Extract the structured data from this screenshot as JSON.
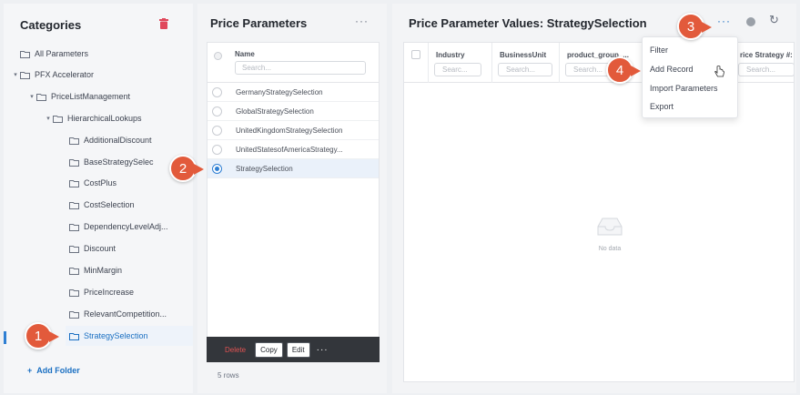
{
  "categories": {
    "title": "Categories",
    "items": [
      {
        "label": "All Parameters"
      },
      {
        "label": "PFX Accelerator"
      },
      {
        "label": "PriceListManagement"
      },
      {
        "label": "HierarchicalLookups"
      },
      {
        "label": "AdditionalDiscount"
      },
      {
        "label": "BaseStrategySelec"
      },
      {
        "label": "CostPlus"
      },
      {
        "label": "CostSelection"
      },
      {
        "label": "DependencyLevelAdj..."
      },
      {
        "label": "Discount"
      },
      {
        "label": "MinMargin"
      },
      {
        "label": "PriceIncrease"
      },
      {
        "label": "RelevantCompetition..."
      },
      {
        "label": "StrategySelection"
      }
    ],
    "add_folder_label": "Add Folder"
  },
  "price_parameters": {
    "title": "Price Parameters",
    "column_name": "Name",
    "search_placeholder": "Search...",
    "rows": [
      {
        "name": "GermanyStrategySelection",
        "selected": false
      },
      {
        "name": "GlobalStrategySelection",
        "selected": false
      },
      {
        "name": "UnitedKingdomStrategySelection",
        "selected": false
      },
      {
        "name": "UnitedStatesofAmericaStrategy...",
        "selected": false
      },
      {
        "name": "StrategySelection",
        "selected": true
      }
    ],
    "toolbar": {
      "delete": "Delete",
      "copy": "Copy",
      "edit": "Edit"
    },
    "rows_count": "5 rows"
  },
  "values": {
    "title": "Price Parameter Values: StrategySelection",
    "columns": [
      {
        "name": "Industry",
        "search": "Searc..."
      },
      {
        "name": "BusinessUnit",
        "search": "Search..."
      },
      {
        "name": "product_group_...",
        "search": "Search..."
      },
      {
        "name": "rice Strategy #:",
        "search": "Search..."
      }
    ],
    "empty_text": "No data"
  },
  "menu": {
    "items": [
      "Filter",
      "Add Record",
      "Import Parameters",
      "Export"
    ]
  },
  "steps": [
    "1",
    "2",
    "3",
    "4"
  ],
  "colors": {
    "accent": "#2f7fd3",
    "badge": "#e25a3b",
    "delete": "#e05252"
  }
}
